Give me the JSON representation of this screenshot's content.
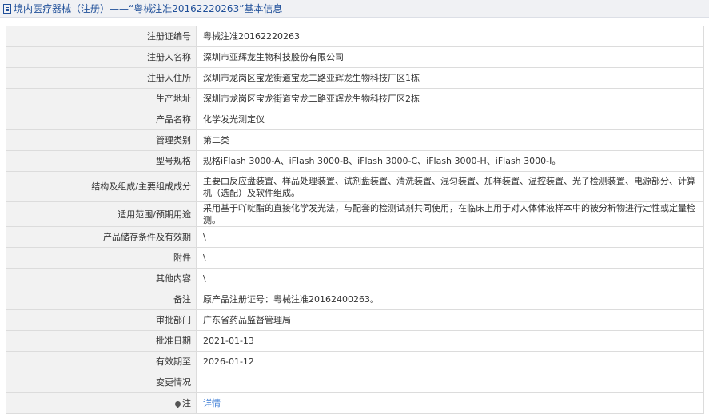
{
  "header": {
    "title": "境内医疗器械（注册）——“粤械注准20162220263”基本信息"
  },
  "rows": [
    {
      "label": "注册证编号",
      "value": "粤械注准20162220263"
    },
    {
      "label": "注册人名称",
      "value": "深圳市亚辉龙生物科技股份有限公司"
    },
    {
      "label": "注册人住所",
      "value": "深圳市龙岗区宝龙街道宝龙二路亚辉龙生物科技厂区1栋"
    },
    {
      "label": "生产地址",
      "value": "深圳市龙岗区宝龙街道宝龙二路亚辉龙生物科技厂区2栋"
    },
    {
      "label": "产品名称",
      "value": "化学发光测定仪"
    },
    {
      "label": "管理类别",
      "value": "第二类"
    },
    {
      "label": "型号规格",
      "value": "规格iFlash 3000-A、iFlash 3000-B、iFlash 3000-C、iFlash 3000-H、iFlash 3000-I。"
    },
    {
      "label": "结构及组成/主要组成成分",
      "value": "主要由反应盘装置、样品处理装置、试剂盘装置、清洗装置、混匀装置、加样装置、温控装置、光子检测装置、电源部分、计算机（选配）及软件组成。"
    },
    {
      "label": "适用范围/预期用途",
      "value": "采用基于吖啶酯的直接化学发光法，与配套的检测试剂共同使用，在临床上用于对人体体液样本中的被分析物进行定性或定量检测。"
    },
    {
      "label": "产品储存条件及有效期",
      "value": "\\"
    },
    {
      "label": "附件",
      "value": "\\"
    },
    {
      "label": "其他内容",
      "value": "\\"
    },
    {
      "label": "备注",
      "value": "原产品注册证号：粤械注准20162400263。"
    },
    {
      "label": "审批部门",
      "value": "广东省药品监督管理局"
    },
    {
      "label": "批准日期",
      "value": "2021-01-13"
    },
    {
      "label": "有效期至",
      "value": "2026-01-12"
    },
    {
      "label": "变更情况",
      "value": ""
    },
    {
      "label": "注",
      "value": "详情"
    }
  ]
}
